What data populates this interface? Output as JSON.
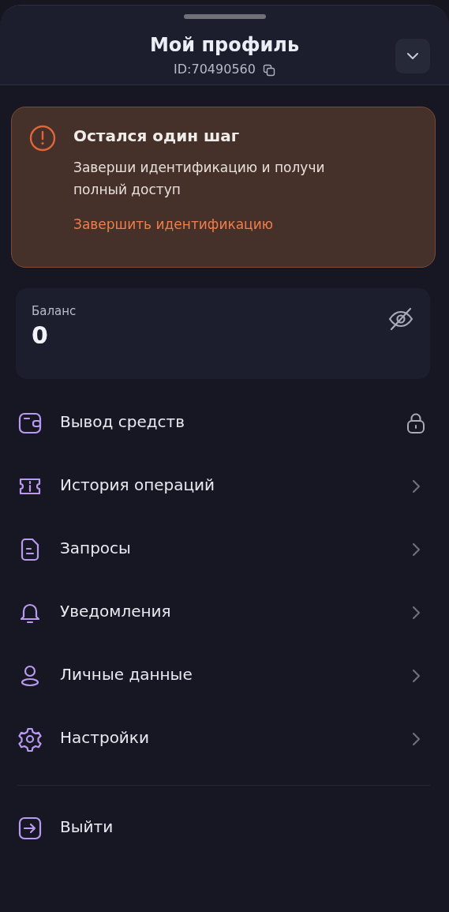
{
  "header": {
    "title": "Мой профиль",
    "id_label": "ID:",
    "id_value": "70490560"
  },
  "alert": {
    "title": "Остался один шаг",
    "text": "Заверши идентификацию и получи полный доступ",
    "link": "Завершить идентификацию"
  },
  "balance": {
    "label": "Баланс",
    "value": "0",
    "hidden": true
  },
  "menu": [
    {
      "label": "Вывод средств",
      "locked": true
    },
    {
      "label": "История операций",
      "locked": false
    },
    {
      "label": "Запросы",
      "locked": false
    },
    {
      "label": "Уведомления",
      "locked": false
    },
    {
      "label": "Личные данные",
      "locked": false
    },
    {
      "label": "Настройки",
      "locked": false
    }
  ],
  "logout": {
    "label": "Выйти"
  }
}
